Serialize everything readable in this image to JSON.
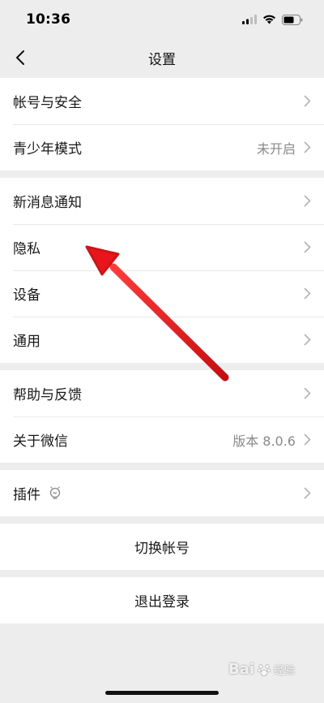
{
  "status_bar": {
    "time": "10:36"
  },
  "nav": {
    "title": "设置"
  },
  "groups": [
    {
      "items": [
        {
          "label": "帐号与安全",
          "value": ""
        },
        {
          "label": "青少年模式",
          "value": "未开启"
        }
      ]
    },
    {
      "items": [
        {
          "label": "新消息通知",
          "value": ""
        },
        {
          "label": "隐私",
          "value": ""
        },
        {
          "label": "设备",
          "value": ""
        },
        {
          "label": "通用",
          "value": ""
        }
      ]
    },
    {
      "items": [
        {
          "label": "帮助与反馈",
          "value": ""
        },
        {
          "label": "关于微信",
          "value": "版本 8.0.6"
        }
      ]
    },
    {
      "items": [
        {
          "label": "插件",
          "icon": "plugin-lightbulb-icon"
        }
      ]
    }
  ],
  "actions": {
    "switch_account": "切换帐号",
    "logout": "退出登录"
  },
  "watermark": {
    "brand": "Bai",
    "sub": "经验"
  },
  "colors": {
    "annotation_arrow": "#e8161a",
    "background": "#ededed"
  }
}
